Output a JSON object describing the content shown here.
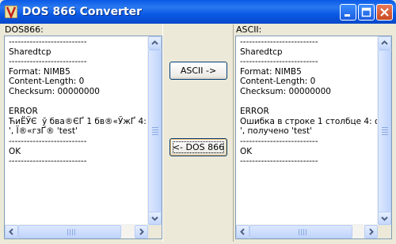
{
  "window": {
    "title": "DOS 866 Converter",
    "controls": {
      "minimize": "minimize",
      "maximize": "maximize",
      "close": "close"
    }
  },
  "left_pane": {
    "label": "DOS866:",
    "text": "--------------------------\nSharedtcp\n--------------------------\nFormat: NIMB5\nContent-Length: 0\nChecksum: 00000000\n\nERROR\nЋиЁЎЄ  ў бва®ЄҐ 1 бв®«ЎжҐ 4: ®\n', Ї®«гзҐ­® 'test'\n--------------------------\nOK\n--------------------------"
  },
  "right_pane": {
    "label": "ASCII:",
    "text": "--------------------------\nSharedtcp\n--------------------------\nFormat: NIMB5\nContent-Length: 0\nChecksum: 00000000\n\nERROR\nОшибка в строке 1 столбце 4: ожи\n', получено 'test'\n--------------------------\nOK\n--------------------------"
  },
  "buttons": {
    "to_ascii": "ASCII ->",
    "to_dos866": "<- DOS 866"
  },
  "colors": {
    "titlebar": "#0a5ae6",
    "face": "#ece9d8",
    "textbox_border": "#7f9db9"
  }
}
